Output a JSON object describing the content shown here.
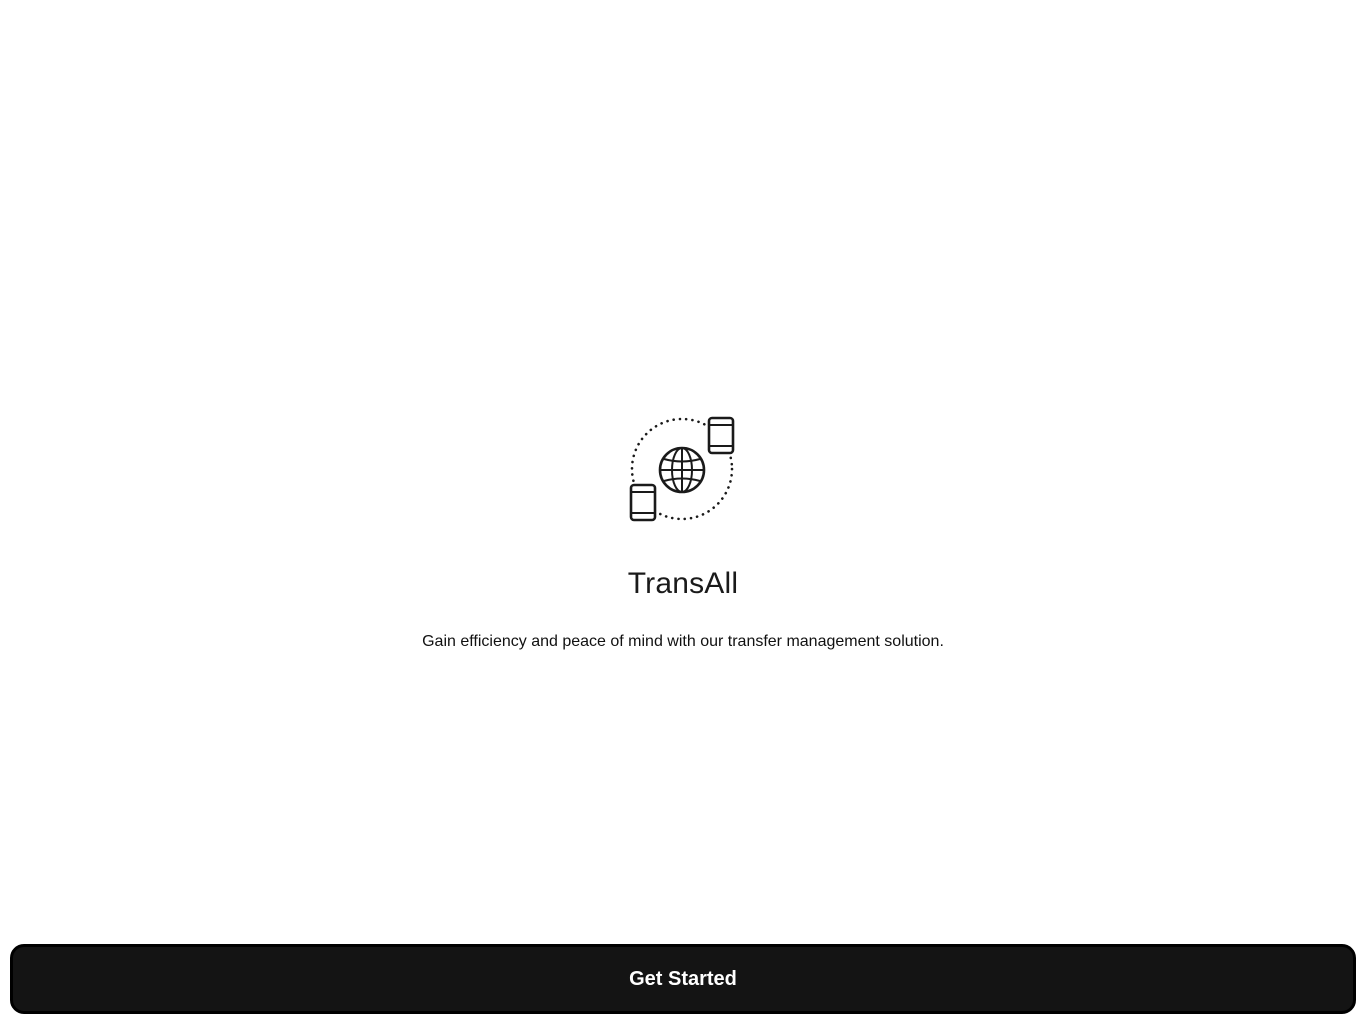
{
  "app": {
    "title": "TransAll",
    "tagline": "Gain efficiency and peace of mind with our transfer management solution.",
    "logo_icon": "globe-transfer-icon"
  },
  "actions": {
    "get_started_label": "Get Started"
  },
  "colors": {
    "background": "#ffffff",
    "button_background": "#141414",
    "button_text": "#ffffff",
    "title_text": "#1a1a1a"
  }
}
